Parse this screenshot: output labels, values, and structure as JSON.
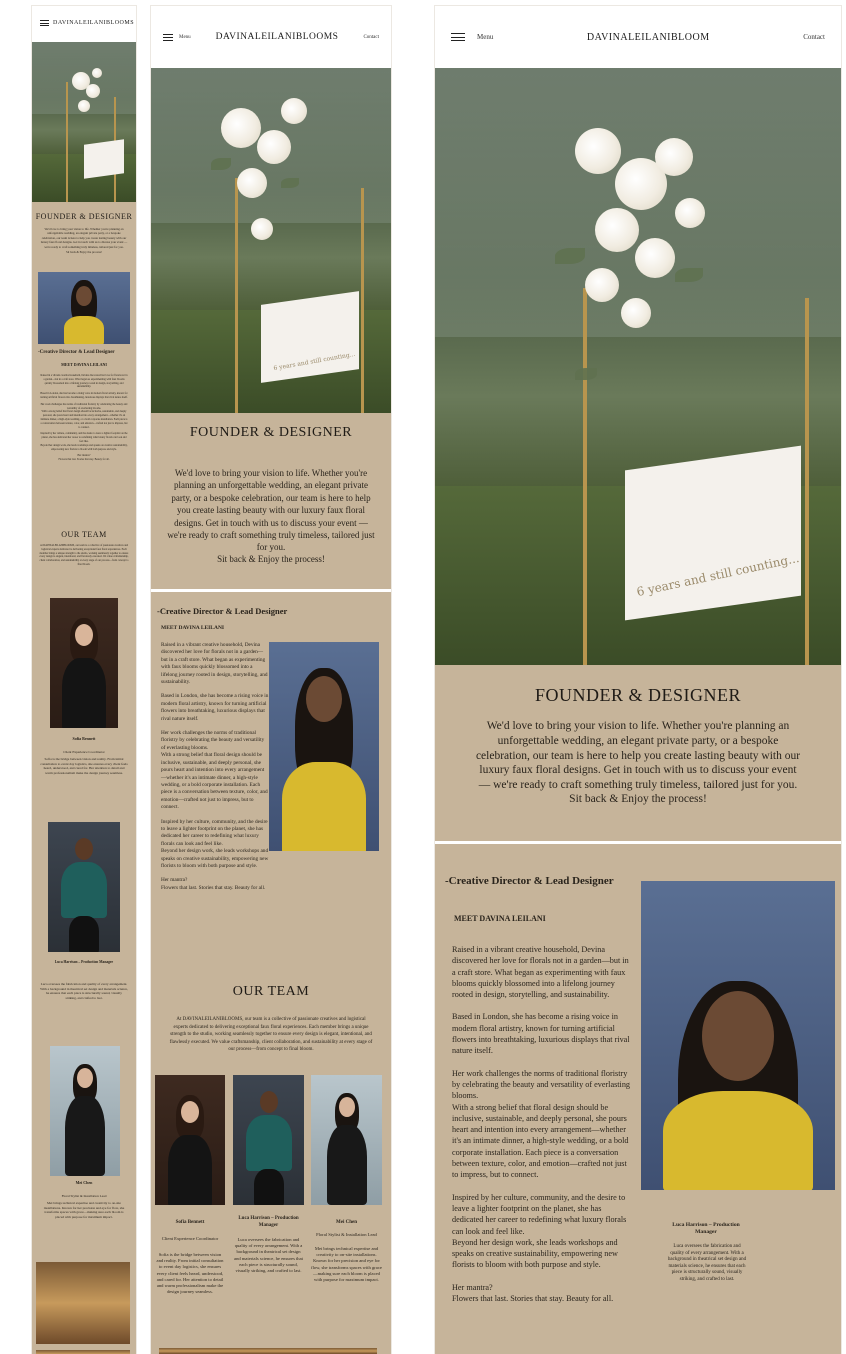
{
  "nav": {
    "brand": "DAVINALEILANIBLOOMS",
    "brand_large": "DAVINALEILANIBLOOM",
    "menu_label": "Menu",
    "contact_label": "Contact"
  },
  "hero": {
    "sign_line": "6 years and still counting..."
  },
  "founder": {
    "title": "FOUNDER & DESIGNER",
    "intro": "We'd love to bring your vision to life. Whether you're planning an unforgettable wedding, an elegant private party, or a bespoke celebration, our team is here to help you create lasting beauty with our luxury faux floral designs. Get in touch with us to discuss your event — we're ready to craft something truly timeless, tailored just for you.",
    "closing": "Sit back & Enjoy the process!"
  },
  "director": {
    "role": "-Creative Director & Lead Designer",
    "meet": "MEET DAVINA LEILANI",
    "p1": "Raised in a vibrant creative household, Devina discovered her love for florals not in a garden—but in a craft store. What began as experimenting with faux blooms quickly blossomed into a lifelong journey rooted in design, storytelling, and sustainability.",
    "p2": "Based in London, she has become a rising voice in modern floral artistry, known for turning artificial flowers into breathtaking, luxurious displays that rival nature itself.",
    "p3": "Her work challenges the norms of traditional floristry by celebrating the beauty and versatility of everlasting blooms.",
    "p4": "With a strong belief that floral design should be inclusive, sustainable, and deeply personal, she pours heart and intention into every arrangement—whether it's an intimate dinner, a high-style wedding, or a bold corporate installation. Each piece is a conversation between texture, color, and emotion—crafted not just to impress, but to connect.",
    "p5": "Inspired by her culture, community, and the desire to leave a lighter footprint on the planet, she has dedicated her career to redefining what luxury florals can look and feel like.",
    "p6": "Beyond her design work, she leads workshops and speaks on creative sustainability, empowering new florists to bloom with both purpose and style.",
    "mantra_label": "Her mantra?",
    "mantra": "Flowers that last. Stories that stay. Beauty for all."
  },
  "team": {
    "title": "OUR TEAM",
    "intro": "At DAVINALEILANIBLOOMS, our team is a collective of passionate creatives and logistical experts dedicated to delivering exceptional faux floral experiences. Each member brings a unique strength to the studio, working seamlessly together to ensure every design is elegant, intentional, and flawlessly executed. We value craftsmanship, client collaboration, and sustainability at every stage of our process—from concept to final bloom.",
    "members": [
      {
        "name": "Sofia Bennett",
        "role": "Client Experience Coordinator",
        "bio": "Sofia is the bridge between vision and reality. From initial consultation to event day logistics, she ensures every client feels heard, understood, and cared for. Her attention to detail and warm professionalism make the design journey seamless."
      },
      {
        "name": "Luca Harrison – Production Manager",
        "role": "",
        "bio": "Luca oversees the fabrication and quality of every arrangement. With a background in theatrical set design and materials science, he ensures that each piece is structurally sound, visually striking, and crafted to last."
      },
      {
        "name": "Mei Chen",
        "role": "Floral Stylist & Installation Lead",
        "bio": "Mei brings technical expertise and creativity to on-site installations. Known for her precision and eye for flow, she transforms spaces with grace—making sure each bloom is placed with purpose for maximum impact."
      }
    ]
  }
}
